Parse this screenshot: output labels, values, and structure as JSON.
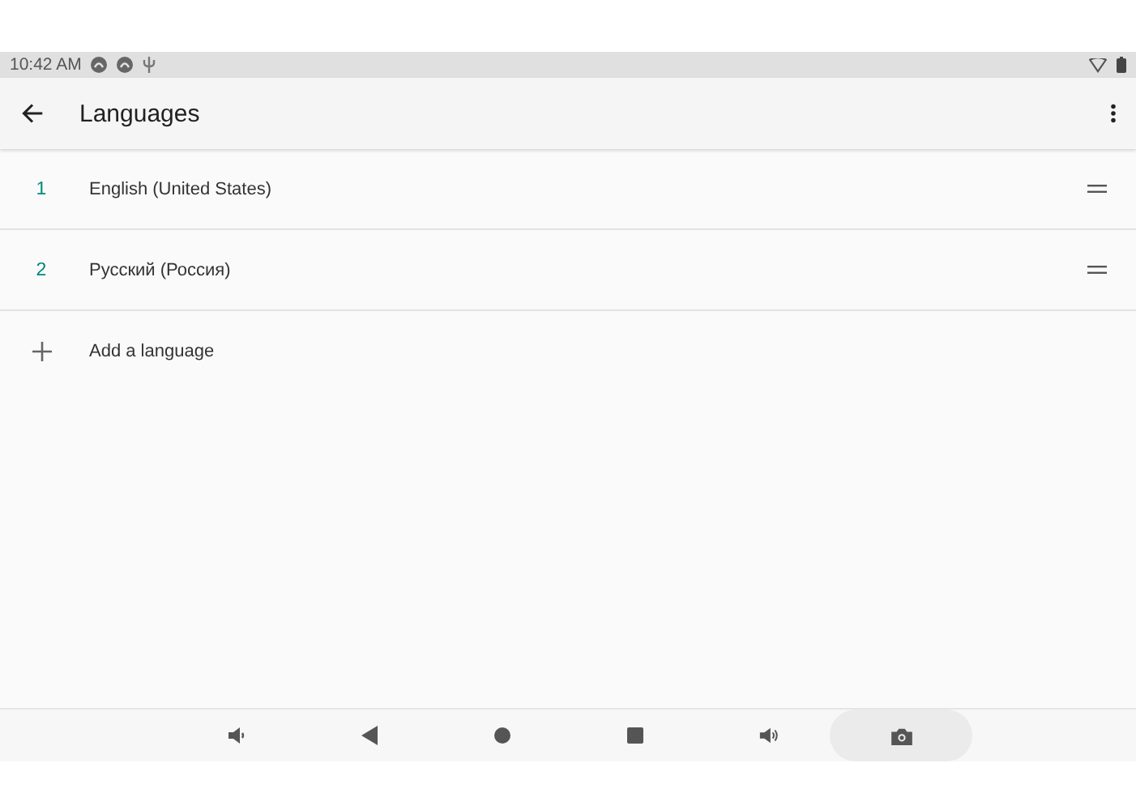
{
  "status_bar": {
    "time": "10:42 AM"
  },
  "app_bar": {
    "title": "Languages"
  },
  "languages": [
    {
      "number": "1",
      "name": "English (United States)"
    },
    {
      "number": "2",
      "name": "Русский (Россия)"
    }
  ],
  "add_item": {
    "label": "Add a language"
  }
}
